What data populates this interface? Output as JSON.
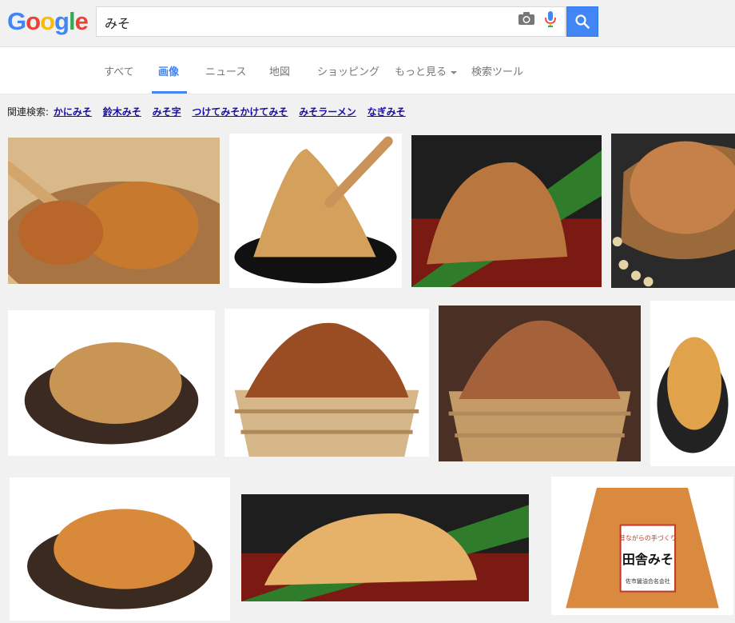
{
  "logo": {
    "letters": [
      "G",
      "o",
      "o",
      "g",
      "l",
      "e"
    ],
    "colors": [
      "#4285f4",
      "#ea4335",
      "#fbbc05",
      "#4285f4",
      "#34a853",
      "#ea4335"
    ]
  },
  "search": {
    "query": "みそ"
  },
  "tabs": [
    {
      "label": "すべて",
      "active": false
    },
    {
      "label": "画像",
      "active": true
    },
    {
      "label": "ニュース",
      "active": false
    },
    {
      "label": "地図",
      "active": false
    },
    {
      "label": "ショッピング",
      "active": false
    },
    {
      "label": "もっと見る",
      "active": false
    },
    {
      "label": "検索ツール",
      "active": false
    }
  ],
  "related": {
    "label": "関連検索:",
    "links": [
      "かにみそ",
      "鈴木みそ",
      "みそ字",
      "つけてみそかけてみそ",
      "みそラーメン",
      "なぎみそ"
    ]
  },
  "images": [
    {
      "name": "image-miso-spoon-closeup",
      "bg": "#d9b98a",
      "miso": "#c77a2e",
      "dish": "#a87444",
      "style": "spoon"
    },
    {
      "name": "image-miso-mound-black-plate",
      "bg": "#ffffff",
      "miso": "#d4a15c",
      "dish": "#111111",
      "style": "mound"
    },
    {
      "name": "image-miso-leaf-red-tray",
      "bg": "#1e1e1e",
      "miso": "#b9763f",
      "dish": "#7a1a12",
      "style": "leaf"
    },
    {
      "name": "image-miso-bowl-soybeans",
      "bg": "#2a2a2a",
      "miso": "#c6814a",
      "dish": "#9b6a3a",
      "style": "bowl"
    },
    {
      "name": "image-miso-dark-dish",
      "bg": "#ffffff",
      "miso": "#c99555",
      "dish": "#3a2a22",
      "style": "dish"
    },
    {
      "name": "image-miso-wooden-tub",
      "bg": "#ffffff",
      "miso": "#9a4c22",
      "dish": "#d5b78a",
      "style": "tub"
    },
    {
      "name": "image-miso-tub-spoon-dark",
      "bg": "#4a2f24",
      "miso": "#a5623a",
      "dish": "#c49a66",
      "style": "tub"
    },
    {
      "name": "image-miso-closeup-partial",
      "bg": "#ffffff",
      "miso": "#e0a24a",
      "dish": "#222222",
      "style": "dish"
    },
    {
      "name": "image-miso-brown-plate",
      "bg": "#ffffff",
      "miso": "#d88a3a",
      "dish": "#3b2a20",
      "style": "dish"
    },
    {
      "name": "image-miso-leaf-tray-light",
      "bg": "#1e1e1e",
      "miso": "#e6b26a",
      "dish": "#7a1a12",
      "style": "leaf"
    },
    {
      "name": "image-miso-package",
      "bg": "#ffffff",
      "miso": "#d98a3e",
      "dish": "#e8e0d0",
      "style": "package"
    }
  ],
  "package_label": {
    "title": "田舎みそ",
    "top": "昔ながらの手づくり",
    "maker": "佐市醤油合名会社"
  }
}
